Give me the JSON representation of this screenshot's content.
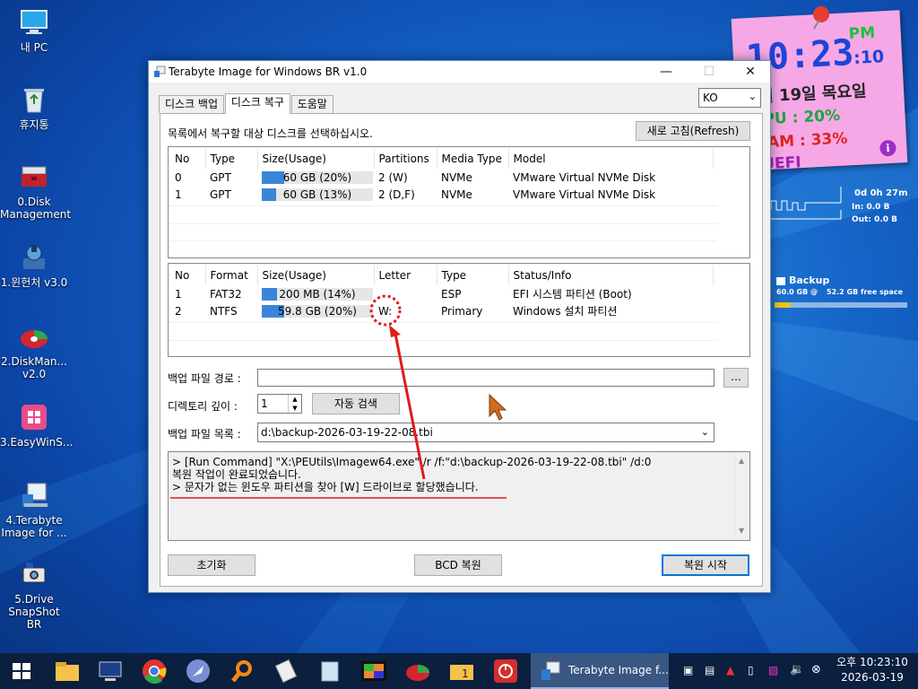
{
  "desktop": {
    "icons": [
      {
        "label": "내 PC",
        "icon": "monitor-icon"
      },
      {
        "label": "휴지통",
        "icon": "recycle-bin-icon"
      },
      {
        "label": "0.Disk\nManagement",
        "icon": "toolbox-icon"
      },
      {
        "label": "1.윈헌처 v3.0",
        "icon": "launcher-icon"
      },
      {
        "label": "2.DiskMan...\nv2.0",
        "icon": "disk-manager-icon"
      },
      {
        "label": "3.EasyWinS...",
        "icon": "windows-logo-icon"
      },
      {
        "label": "4.Terabyte\nImage for ...",
        "icon": "terabyte-icon"
      },
      {
        "label": "5.Drive\nSnapShot BR",
        "icon": "snapshot-icon"
      }
    ]
  },
  "widget": {
    "time": "10:23",
    "ampm": "PM",
    "seconds": ":10",
    "date": "월 19일 목요일",
    "cpu": "PU :  20%",
    "ram": "RAM : 33%",
    "firmware": "UEFI",
    "uptime": "0d 0h 27m",
    "net_in": "In: 0.0 B",
    "net_out": "Out: 0.0 B",
    "backup_label": "Backup",
    "backup_size": "60.0 GB @",
    "backup_free": "52.2 GB free space"
  },
  "window": {
    "title": "Terabyte Image for Windows BR v1.0",
    "minimize": "—",
    "maximize": "☐",
    "close": "✕",
    "tabs": [
      "디스크 백업",
      "디스크 복구",
      "도움말"
    ],
    "active_tab": 1,
    "language": "KO",
    "instruction": "목록에서 복구할 대상 디스크를 선택하십시오.",
    "refresh_button": "새로 고침(Refresh)",
    "disk_columns": [
      "No",
      "Type",
      "Size(Usage)",
      "Partitions",
      "Media Type",
      "Model"
    ],
    "disks": [
      {
        "no": "0",
        "type": "GPT",
        "size": "60 GB (20%)",
        "usage": 0.2,
        "partitions": "2 (W)",
        "media": "NVMe",
        "model": "VMware Virtual NVMe Disk"
      },
      {
        "no": "1",
        "type": "GPT",
        "size": "60 GB (13%)",
        "usage": 0.13,
        "partitions": "2 (D,F)",
        "media": "NVMe",
        "model": "VMware Virtual NVMe Disk"
      }
    ],
    "partition_columns": [
      "No",
      "Format",
      "Size(Usage)",
      "Letter",
      "Type",
      "Status/Info"
    ],
    "partitions": [
      {
        "no": "1",
        "format": "FAT32",
        "size": "200 MB (14%)",
        "usage": 0.14,
        "letter": "",
        "type": "ESP",
        "info": "EFI 시스템 파티션 (Boot)"
      },
      {
        "no": "2",
        "format": "NTFS",
        "size": "59.8 GB (20%)",
        "usage": 0.2,
        "letter": "W:",
        "type": "Primary",
        "info": "Windows 설치 파티션"
      }
    ],
    "backup_path_label": "백업 파일 경로 :",
    "backup_path_value": "",
    "browse_button": "...",
    "depth_label": "디렉토리 깊이 :",
    "depth_value": "1",
    "auto_search_button": "자동 검색",
    "backup_list_label": "백업 파일 목록 :",
    "backup_list_value": "d:\\backup-2026-03-19-22-08.tbi",
    "log_lines": [
      "> [Run Command] \"X:\\PEUtils\\Imagew64.exe\" /r /f:\"d:\\backup-2026-03-19-22-08.tbi\" /d:0",
      "복원 작업이 완료되었습니다.",
      "> 문자가 없는 윈도우 파티션을 찾아 [W] 드라이브로 할당했습니다."
    ],
    "reset_button": "초기화",
    "bcd_button": "BCD 복원",
    "start_button": "복원 시작"
  },
  "taskbar": {
    "active_app": "Terabyte Image f...",
    "clock_time": "오후 10:23:10",
    "clock_date": "2026-03-19"
  },
  "colors": {
    "accent": "#0078d7",
    "bar_fill": "#3a85d8",
    "annotation": "#e21b1b",
    "sticky_bg": "#f6a8e6"
  }
}
